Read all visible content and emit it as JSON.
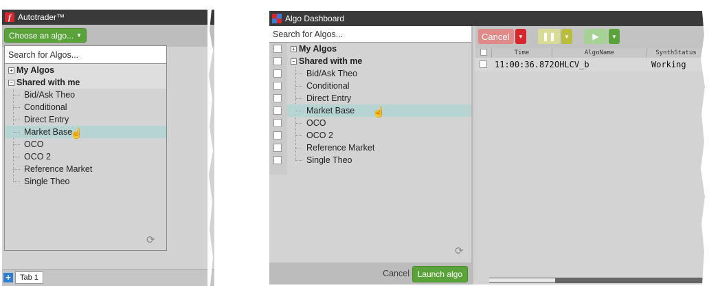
{
  "left_window": {
    "title": "Autotrader™",
    "choose_algo_label": "Choose an algo...",
    "search_placeholder": "Search for Algos...",
    "groups": {
      "my_algos": "My Algos",
      "shared": "Shared with me"
    },
    "items": [
      "Bid/Ask Theo",
      "Conditional",
      "Direct Entry",
      "Market Base",
      "OCO",
      "OCO 2",
      "Reference Market",
      "Single Theo"
    ],
    "selected_item": "Market Base",
    "tab_label": "Tab 1",
    "add_tab_symbol": "+"
  },
  "right_window": {
    "title": "Algo Dashboard",
    "search_placeholder": "Search for Algos...",
    "groups": {
      "my_algos": "My Algos",
      "shared": "Shared with me"
    },
    "items": [
      "Bid/Ask Theo",
      "Conditional",
      "Direct Entry",
      "Market Base",
      "OCO",
      "OCO 2",
      "Reference Market",
      "Single Theo"
    ],
    "selected_item": "Market Base",
    "footer": {
      "cancel_label": "Cancel",
      "launch_label": "Launch algo"
    },
    "toolbar": {
      "cancel_label": "Cancel"
    },
    "grid": {
      "columns": [
        "Time",
        "AlgoName",
        "SynthStatus"
      ],
      "rows": [
        {
          "time": "11:00:36.872",
          "algo_name": "OHLCV_b",
          "status": "Working"
        }
      ]
    }
  },
  "colors": {
    "accent_green": "#5aa33a",
    "cancel_red": "#d7262c",
    "pause_olive": "#b8bd3a",
    "selection": "#b6d4d2",
    "titlebar": "#3a3a3a"
  },
  "icons": [
    "autotrader-logo-icon",
    "dashboard-logo-icon",
    "refresh-icon",
    "hand-cursor-icon",
    "pause-icon",
    "play-icon",
    "chevron-down-icon",
    "plus-icon"
  ]
}
